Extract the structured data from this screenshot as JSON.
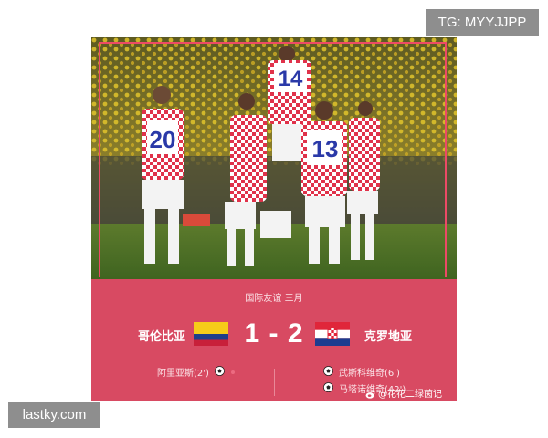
{
  "badges": {
    "top_right": "TG: MYYJJPP",
    "bottom_left": "lastky.com"
  },
  "match": {
    "event": "国际友谊  三月",
    "home_team": "哥伦比亚",
    "away_team": "克罗地亚",
    "score": "1 - 2",
    "home_scorers": [
      "阿里亚斯(2')"
    ],
    "away_scorers": [
      "武斯科维奇(6')",
      "马塔诺维奇(42')"
    ]
  },
  "photo": {
    "jersey_numbers": [
      "20",
      "14",
      "13"
    ]
  },
  "watermark": "@花花二绿茵记",
  "colors": {
    "card_bg": "#d84a62",
    "frame": "#ec4a66",
    "badge_bg": "#8e8e8e"
  }
}
